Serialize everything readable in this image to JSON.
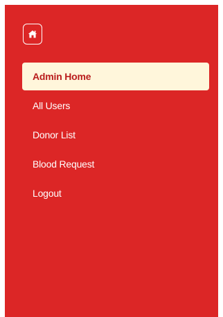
{
  "sidebar": {
    "home_icon": "home-icon",
    "items": [
      {
        "label": "Admin Home",
        "active": true
      },
      {
        "label": "All Users",
        "active": false
      },
      {
        "label": "Donor List",
        "active": false
      },
      {
        "label": "Blood Request",
        "active": false
      },
      {
        "label": "Logout",
        "active": false
      }
    ]
  },
  "colors": {
    "sidebar_bg": "#dc2626",
    "active_bg": "#fff6db",
    "active_text": "#b91c1c",
    "text": "#ffffff"
  }
}
